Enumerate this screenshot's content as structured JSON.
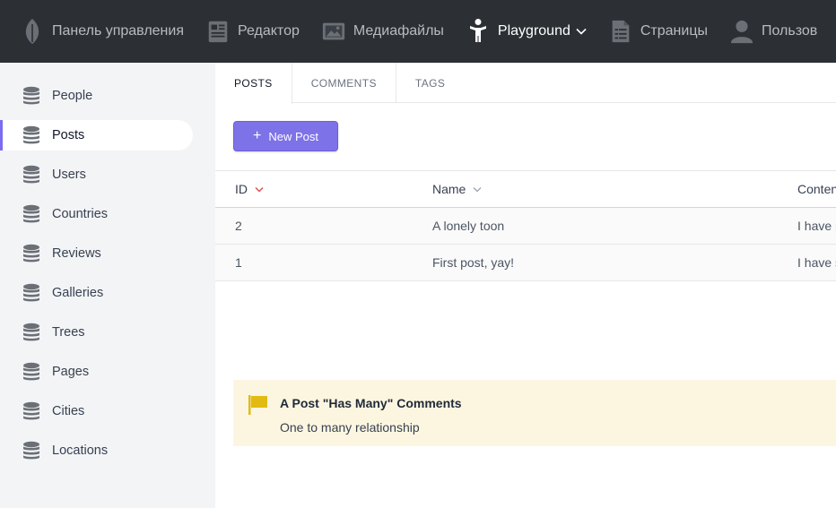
{
  "topnav": {
    "items": [
      {
        "label": "Панель управления",
        "icon": "leaf-icon"
      },
      {
        "label": "Редактор",
        "icon": "newspaper-icon"
      },
      {
        "label": "Медиафайлы",
        "icon": "image-icon"
      },
      {
        "label": "Playground",
        "icon": "child-icon",
        "active": true
      },
      {
        "label": "Страницы",
        "icon": "document-icon"
      },
      {
        "label": "Пользов",
        "icon": "user-icon"
      }
    ]
  },
  "sidebar": {
    "items": [
      {
        "label": "People"
      },
      {
        "label": "Posts",
        "active": true
      },
      {
        "label": "Users"
      },
      {
        "label": "Countries"
      },
      {
        "label": "Reviews"
      },
      {
        "label": "Galleries"
      },
      {
        "label": "Trees"
      },
      {
        "label": "Pages"
      },
      {
        "label": "Cities"
      },
      {
        "label": "Locations"
      }
    ]
  },
  "tabs": [
    {
      "label": "POSTS",
      "active": true
    },
    {
      "label": "COMMENTS"
    },
    {
      "label": "TAGS"
    }
  ],
  "toolbar": {
    "new_label": "New Post"
  },
  "table": {
    "columns": [
      "ID",
      "Name",
      "Conten"
    ],
    "rows": [
      {
        "id": "2",
        "name": "A lonely toon",
        "content": "I have r"
      },
      {
        "id": "1",
        "name": "First post, yay!",
        "content": "I have s"
      }
    ]
  },
  "note": {
    "title": "A Post \"Has Many\" Comments",
    "subtitle": "One to many relationship"
  },
  "colors": {
    "accent": "#7d72e8",
    "topnav_bg": "#2c3035",
    "sidebar_bg": "#f3f4f6",
    "note_bg": "#fcf6e1",
    "flag": "#e1bb12",
    "sort_arrow_active": "#d9534f"
  }
}
